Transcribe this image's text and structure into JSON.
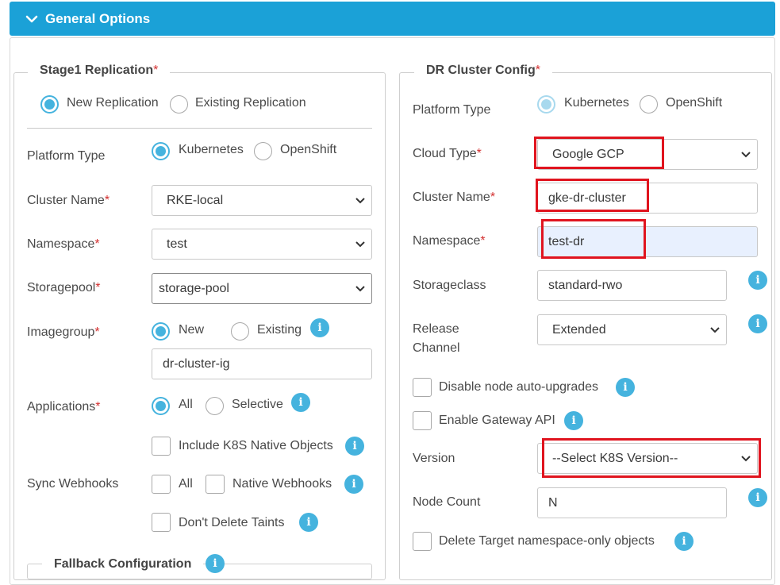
{
  "header": {
    "title": "General Options"
  },
  "stage1": {
    "legend": "Stage1 Replication",
    "replication_options": [
      "New Replication",
      "Existing Replication"
    ],
    "platform_label": "Platform Type",
    "platform_options": [
      "Kubernetes",
      "OpenShift"
    ],
    "cluster_name_label": "Cluster Name",
    "cluster_name_value": "RKE-local",
    "namespace_label": "Namespace",
    "namespace_value": "test",
    "storagepool_label": "Storagepool",
    "storagepool_value": "storage-pool",
    "imagegroup_label": "Imagegroup",
    "imagegroup_options": [
      "New",
      "Existing"
    ],
    "imagegroup_value": "dr-cluster-ig",
    "applications_label": "Applications",
    "applications_options": [
      "All",
      "Selective"
    ],
    "include_native_label": "Include K8S Native Objects",
    "sync_webhooks_label": "Sync Webhooks",
    "webhook_all_label": "All",
    "webhook_native_label": "Native Webhooks",
    "dont_delete_taints_label": "Don't Delete Taints",
    "fallback_label": "Fallback Configuration"
  },
  "dr": {
    "legend": "DR Cluster Config",
    "platform_label": "Platform Type",
    "platform_options": [
      "Kubernetes",
      "OpenShift"
    ],
    "cloud_type_label": "Cloud Type",
    "cloud_type_value": "Google GCP",
    "cluster_name_label": "Cluster Name",
    "cluster_name_value": "gke-dr-cluster",
    "namespace_label": "Namespace",
    "namespace_value": "test-dr",
    "storageclass_label": "Storageclass",
    "storageclass_value": "standard-rwo",
    "release_channel_label": "Release Channel",
    "release_channel_value": "Extended",
    "disable_upgrades_label": "Disable node auto-upgrades",
    "gateway_api_label": "Enable Gateway API",
    "version_label": "Version",
    "version_value": "--Select K8S Version--",
    "node_count_label": "Node Count",
    "node_count_value": "N",
    "delete_target_label": "Delete Target namespace-only objects"
  },
  "colors": {
    "accent": "#1ba1d7",
    "radio": "#45b3de",
    "required": "#d32f2f",
    "highlight": "#e0141e",
    "autofill": "#e8f0fe"
  },
  "icons": [
    "chevron-down-icon",
    "info-icon"
  ]
}
